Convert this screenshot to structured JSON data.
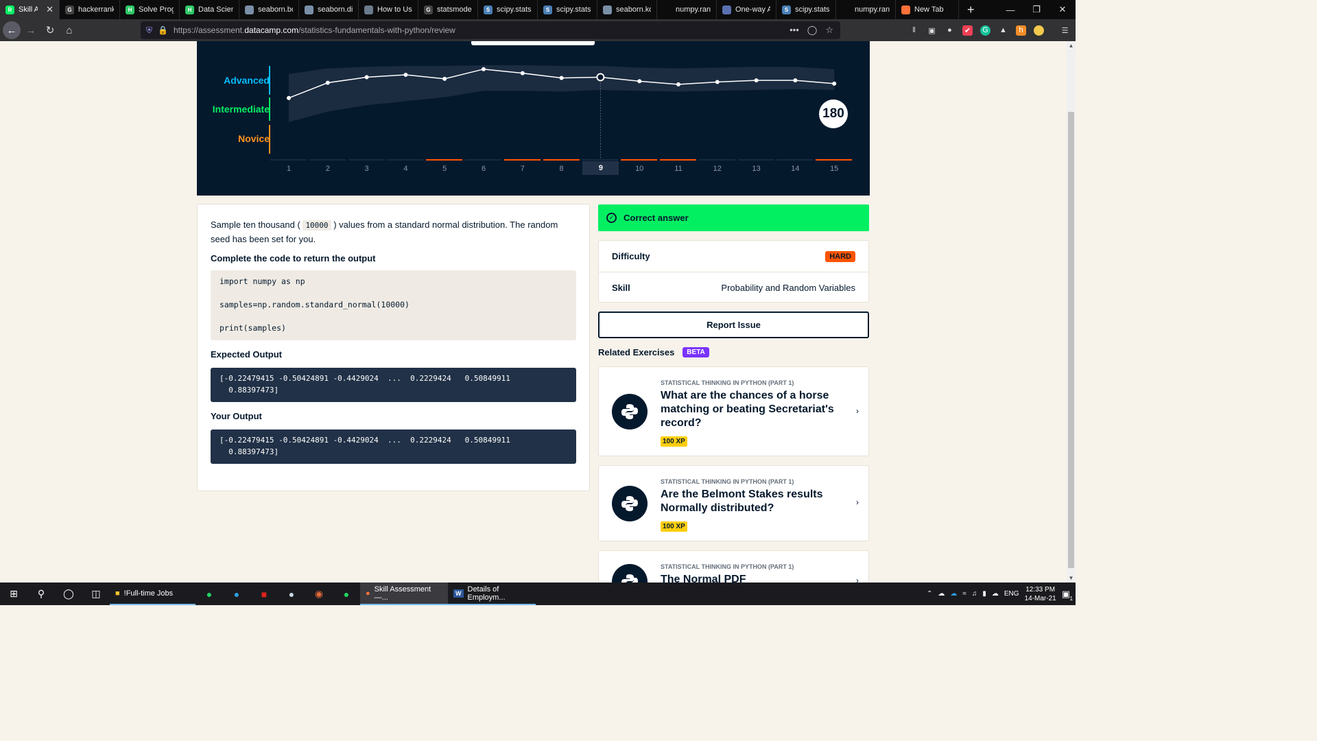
{
  "browser": {
    "tabs": [
      {
        "title": "Skill Ass",
        "fav_text": "R",
        "fav_color": "#03ef62",
        "active": true
      },
      {
        "title": "hackerrank",
        "fav_text": "G",
        "fav_color": "#444444"
      },
      {
        "title": "Solve Progr",
        "fav_text": "H",
        "fav_color": "#2ec866"
      },
      {
        "title": "Data Scienc",
        "fav_text": "H",
        "fav_color": "#2ec866"
      },
      {
        "title": "seaborn.box",
        "fav_text": "",
        "fav_color": "#7a8fa6"
      },
      {
        "title": "seaborn.dist",
        "fav_text": "",
        "fav_color": "#7a8fa6"
      },
      {
        "title": "How to Use",
        "fav_text": "",
        "fav_color": "#6b7b8c"
      },
      {
        "title": "statsmodels",
        "fav_text": "G",
        "fav_color": "#444444"
      },
      {
        "title": "scipy.stats.t",
        "fav_text": "S",
        "fav_color": "#4a7fb5"
      },
      {
        "title": "scipy.stats.t",
        "fav_text": "S",
        "fav_color": "#4a7fb5"
      },
      {
        "title": "seaborn.kde",
        "fav_text": "",
        "fav_color": "#7a8fa6"
      },
      {
        "title": "numpy.random",
        "fav_text": "",
        "fav_color": ""
      },
      {
        "title": "One-way AI",
        "fav_text": "",
        "fav_color": "#5b6fb0"
      },
      {
        "title": "scipy.stats.f",
        "fav_text": "S",
        "fav_color": "#4a7fb5"
      },
      {
        "title": "numpy.random",
        "fav_text": "",
        "fav_color": ""
      },
      {
        "title": "New Tab",
        "fav_text": "",
        "fav_color": "#ff7139"
      }
    ],
    "new_tab_label": "+",
    "url_prefix": "https://assessment.",
    "url_host": "datacamp.com",
    "url_path": "/statistics-fundamentals-with-python/review",
    "url_more": "•••"
  },
  "chart_data": {
    "type": "line",
    "x": [
      1,
      2,
      3,
      4,
      5,
      6,
      7,
      8,
      9,
      10,
      11,
      12,
      13,
      14,
      15
    ],
    "xticks": [
      "1",
      "2",
      "3",
      "4",
      "5",
      "6",
      "7",
      "8",
      "9",
      "10",
      "11",
      "12",
      "13",
      "14",
      "15"
    ],
    "y": [
      139,
      158,
      165,
      168,
      163,
      175,
      170,
      164,
      165,
      160,
      156,
      159,
      161,
      161,
      157
    ],
    "band_upper": [
      169,
      176,
      178,
      179,
      179,
      180,
      180,
      179,
      179,
      177,
      176,
      177,
      178,
      178,
      175
    ],
    "band_lower": [
      109,
      122,
      130,
      135,
      140,
      148,
      148,
      147,
      149,
      148,
      147,
      148,
      149,
      150,
      149
    ],
    "ylim": [
      90,
      180
    ],
    "levels": [
      {
        "label": "Advanced",
        "color": "#06bdfc"
      },
      {
        "label": "Intermediate",
        "color": "#03ef62"
      },
      {
        "label": "Novice",
        "color": "#ff931e"
      }
    ],
    "highlight_step": 9,
    "incorrect_steps": [
      5,
      7,
      8,
      10,
      11,
      15
    ],
    "score": "180"
  },
  "question": {
    "text_before": "Sample ten thousand (",
    "code_inline": "10000",
    "text_after": ") values from a standard normal distribution. The random seed has been set for you.",
    "complete_heading": "Complete the code to return the output",
    "code_lines": [
      "import numpy as np",
      "samples=np.random.standard_normal(10000)",
      "print(samples)"
    ],
    "expected_heading": "Expected Output",
    "expected_output": "[-0.22479415 -0.50424891 -0.4429024  ...  0.2229424   0.50849911\n  0.88397473]",
    "your_heading": "Your Output",
    "your_output": "[-0.22479415 -0.50424891 -0.4429024  ...  0.2229424   0.50849911\n  0.88397473]"
  },
  "result": {
    "correct_label": "Correct answer",
    "difficulty_label": "Difficulty",
    "difficulty_value": "HARD",
    "skill_label": "Skill",
    "skill_value": "Probability and Random Variables",
    "report_label": "Report Issue"
  },
  "related": {
    "heading": "Related Exercises",
    "badge": "BETA",
    "items": [
      {
        "course": "STATISTICAL THINKING IN PYTHON (PART 1)",
        "title": "What are the chances of a horse matching or beating Secretariat's record?",
        "xp": "100 XP"
      },
      {
        "course": "STATISTICAL THINKING IN PYTHON (PART 1)",
        "title": "Are the Belmont Stakes results Normally distributed?",
        "xp": "100 XP"
      },
      {
        "course": "STATISTICAL THINKING IN PYTHON (PART 1)",
        "title": "The Normal PDF",
        "xp": ""
      }
    ]
  },
  "taskbar": {
    "apps": [
      {
        "label": "!Full-time Jobs",
        "active": false
      },
      {
        "label": "Skill Assessment —...",
        "active": true
      },
      {
        "label": "Details of Employm...",
        "active": false
      }
    ],
    "lang": "ENG",
    "time": "12:33 PM",
    "date": "14-Mar-21",
    "notification_count": "1"
  }
}
